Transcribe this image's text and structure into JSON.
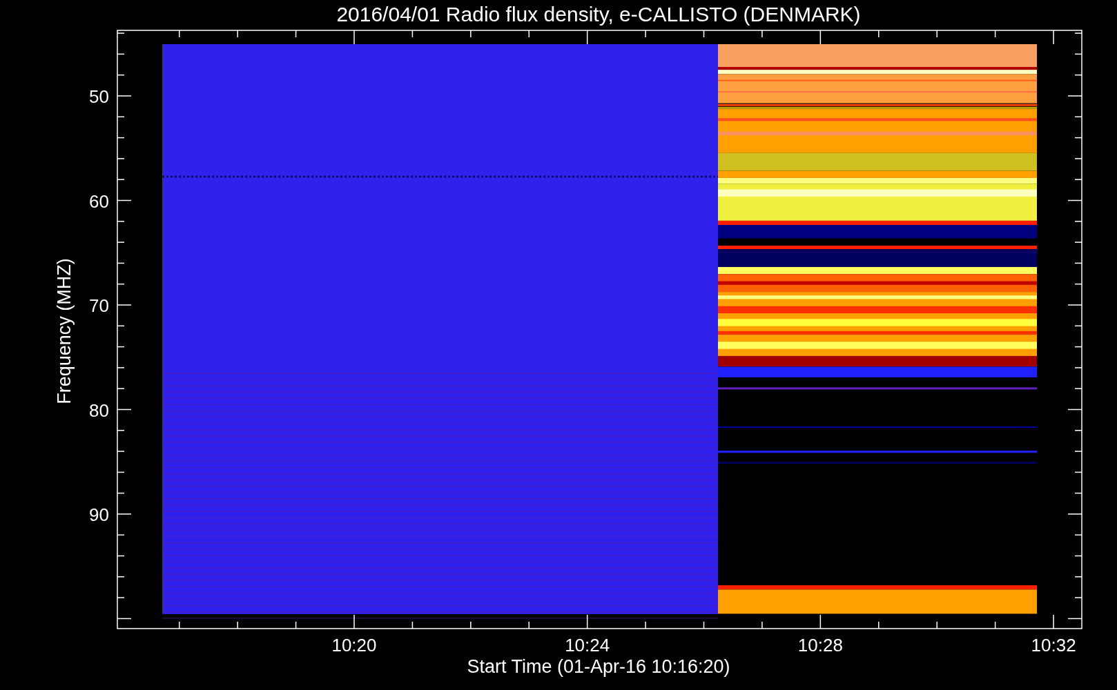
{
  "plot": {
    "title": "2016/04/01  Radio flux density, e-CALLISTO (DENMARK)",
    "xlabel": "Start Time (01-Apr-16 10:16:20)",
    "ylabel": "Frequency (MHZ)",
    "x_tick_labels": [
      "10:20",
      "10:24",
      "10:28",
      "10:32"
    ],
    "y_tick_labels": [
      "50",
      "60",
      "70",
      "80",
      "90"
    ]
  }
}
